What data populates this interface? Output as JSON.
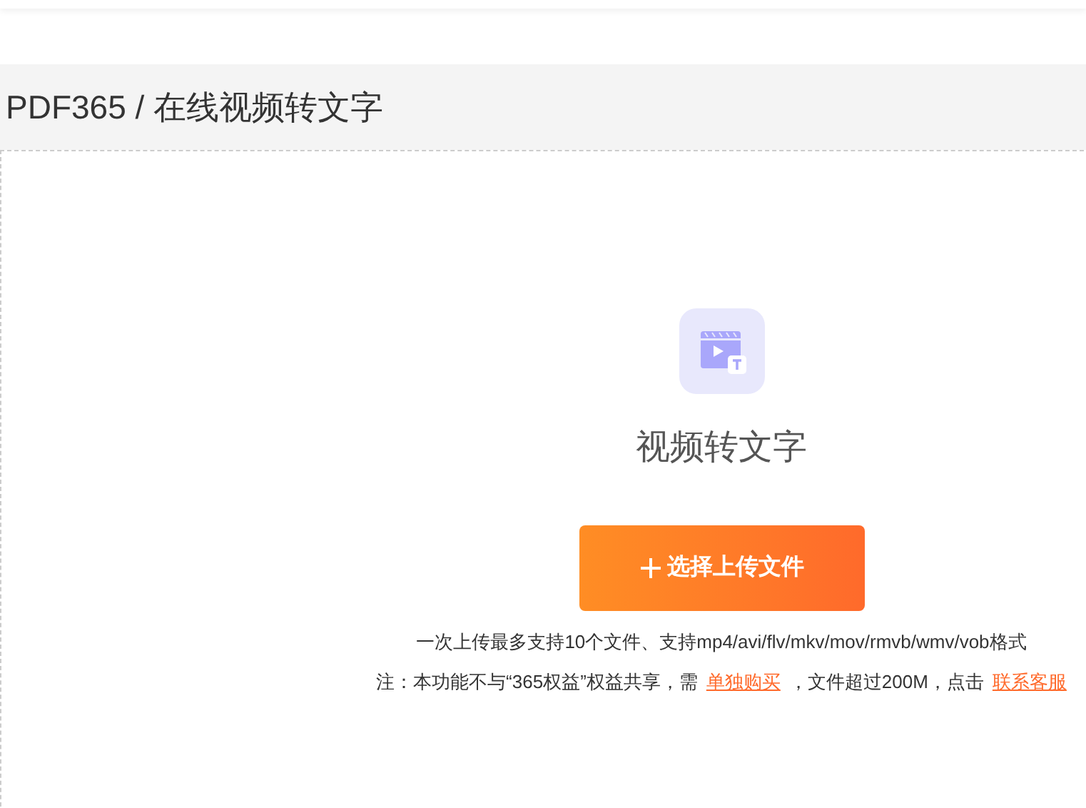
{
  "breadcrumb": "PDF365 / 在线视频转文字",
  "upload": {
    "title": "视频转文字",
    "button": "选择上传文件",
    "hint": "一次上传最多支持10个文件、支持mp4/avi/flv/mkv/mov/rmvb/wmv/vob格式",
    "note": [
      {
        "kind": "text",
        "text": "注：本功能不与“365权益”权益共享，需"
      },
      {
        "kind": "link",
        "text": "单独购买"
      },
      {
        "kind": "text",
        "text": "，文件超过200M，点击"
      },
      {
        "kind": "link",
        "text": "联系客服"
      }
    ]
  }
}
